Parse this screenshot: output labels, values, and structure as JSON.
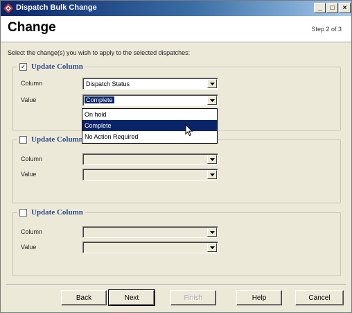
{
  "window": {
    "title": "Dispatch Bulk Change",
    "minimize_glyph": "_",
    "maximize_glyph": "□",
    "close_glyph": "×"
  },
  "header": {
    "title": "Change",
    "step": "Step 2 of 3"
  },
  "instructions": "Select the change(s) you wish to apply to the selected dispatches:",
  "groups": [
    {
      "checked": true,
      "check_glyph": "✓",
      "legend": "Update Column",
      "column_label": "Column",
      "column_value": "Dispatch Status",
      "value_label": "Value",
      "value_value": "Complete"
    },
    {
      "checked": false,
      "check_glyph": "",
      "legend": "Update Column",
      "column_label": "Column",
      "column_value": "",
      "value_label": "Value",
      "value_value": ""
    },
    {
      "checked": false,
      "check_glyph": "",
      "legend": "Update Column",
      "column_label": "Column",
      "column_value": "",
      "value_label": "Value",
      "value_value": ""
    }
  ],
  "dropdown": {
    "options": [
      "On hold",
      "Complete",
      "No Action Required"
    ],
    "highlighted": "Complete"
  },
  "buttons": {
    "back": "Back",
    "next": "Next",
    "finish": "Finish",
    "help": "Help",
    "cancel": "Cancel"
  },
  "colors": {
    "titlebar_start": "#0a246a",
    "selection": "#0a246a",
    "legend_text": "#2a4a8a",
    "dialog_bg": "#ece9d8"
  },
  "icons": {
    "app": "dispatch-app-icon",
    "dropdown_arrow": "chevron-down-icon",
    "cursor": "mouse-pointer-icon"
  }
}
